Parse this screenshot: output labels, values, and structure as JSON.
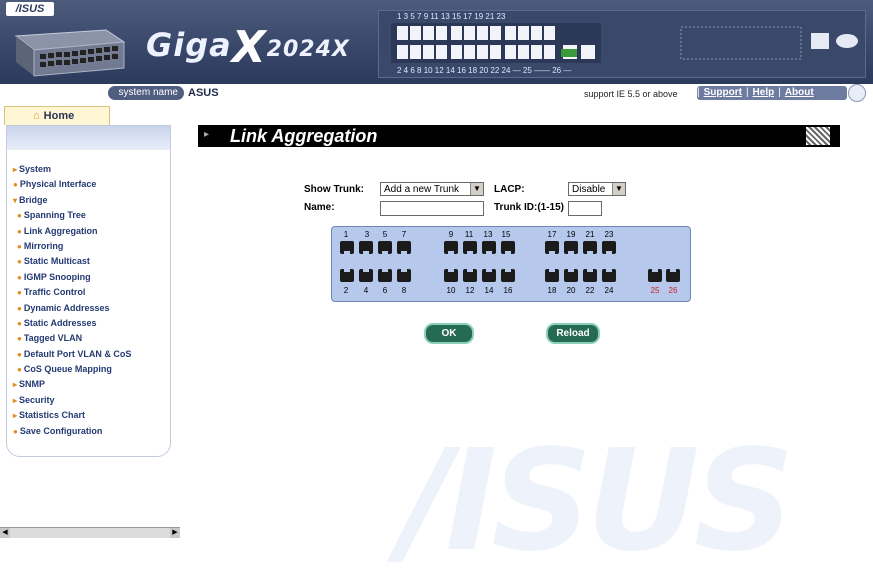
{
  "header": {
    "logo_text": "/ISUS",
    "brand_prefix": "Giga",
    "brand_x": "X",
    "brand_model": "2024X",
    "port_numbers_top": "1   3   5   7     9   11   13   15    17   19   21   23",
    "port_numbers_bottom": "2   4   6   8    10   12   14   16    18   20   22   24   — 25 —— 26 —"
  },
  "system_bar": {
    "label": "system name",
    "value": "ASUS",
    "support_text": "support IE 5.5 or above",
    "links": [
      "Support",
      "Help",
      "About"
    ]
  },
  "home_tab": "Home",
  "nav": [
    {
      "label": "System",
      "sub": false
    },
    {
      "label": "Physical Interface",
      "sub": false
    },
    {
      "label": "Bridge",
      "sub": false
    },
    {
      "label": "Spanning Tree",
      "sub": true
    },
    {
      "label": "Link Aggregation",
      "sub": true
    },
    {
      "label": "Mirroring",
      "sub": true
    },
    {
      "label": "Static Multicast",
      "sub": true
    },
    {
      "label": "IGMP Snooping",
      "sub": true
    },
    {
      "label": "Traffic Control",
      "sub": true
    },
    {
      "label": "Dynamic Addresses",
      "sub": true
    },
    {
      "label": "Static Addresses",
      "sub": true
    },
    {
      "label": "Tagged VLAN",
      "sub": true
    },
    {
      "label": "Default Port VLAN & CoS",
      "sub": true
    },
    {
      "label": "CoS Queue Mapping",
      "sub": true
    },
    {
      "label": "SNMP",
      "sub": false
    },
    {
      "label": "Security",
      "sub": false
    },
    {
      "label": "Statistics Chart",
      "sub": false
    },
    {
      "label": "Save Configuration",
      "sub": false
    }
  ],
  "page_title": "Link Aggregation",
  "form": {
    "show_trunk_label": "Show Trunk:",
    "show_trunk_value": "Add a new Trunk",
    "lacp_label": "LACP:",
    "lacp_value": "Disable",
    "name_label": "Name:",
    "name_value": "",
    "trunk_id_label": "Trunk ID:(1-15)",
    "trunk_id_value": ""
  },
  "ports": {
    "top": [
      "1",
      "3",
      "5",
      "7",
      "9",
      "11",
      "13",
      "15",
      "17",
      "19",
      "21",
      "23"
    ],
    "bottom": [
      "2",
      "4",
      "6",
      "8",
      "10",
      "12",
      "14",
      "16",
      "18",
      "20",
      "22",
      "24"
    ],
    "uplink": [
      "25",
      "26"
    ],
    "uplink_color": "#d02020"
  },
  "buttons": {
    "ok": "OK",
    "reload": "Reload"
  },
  "watermark": "/ISUS"
}
